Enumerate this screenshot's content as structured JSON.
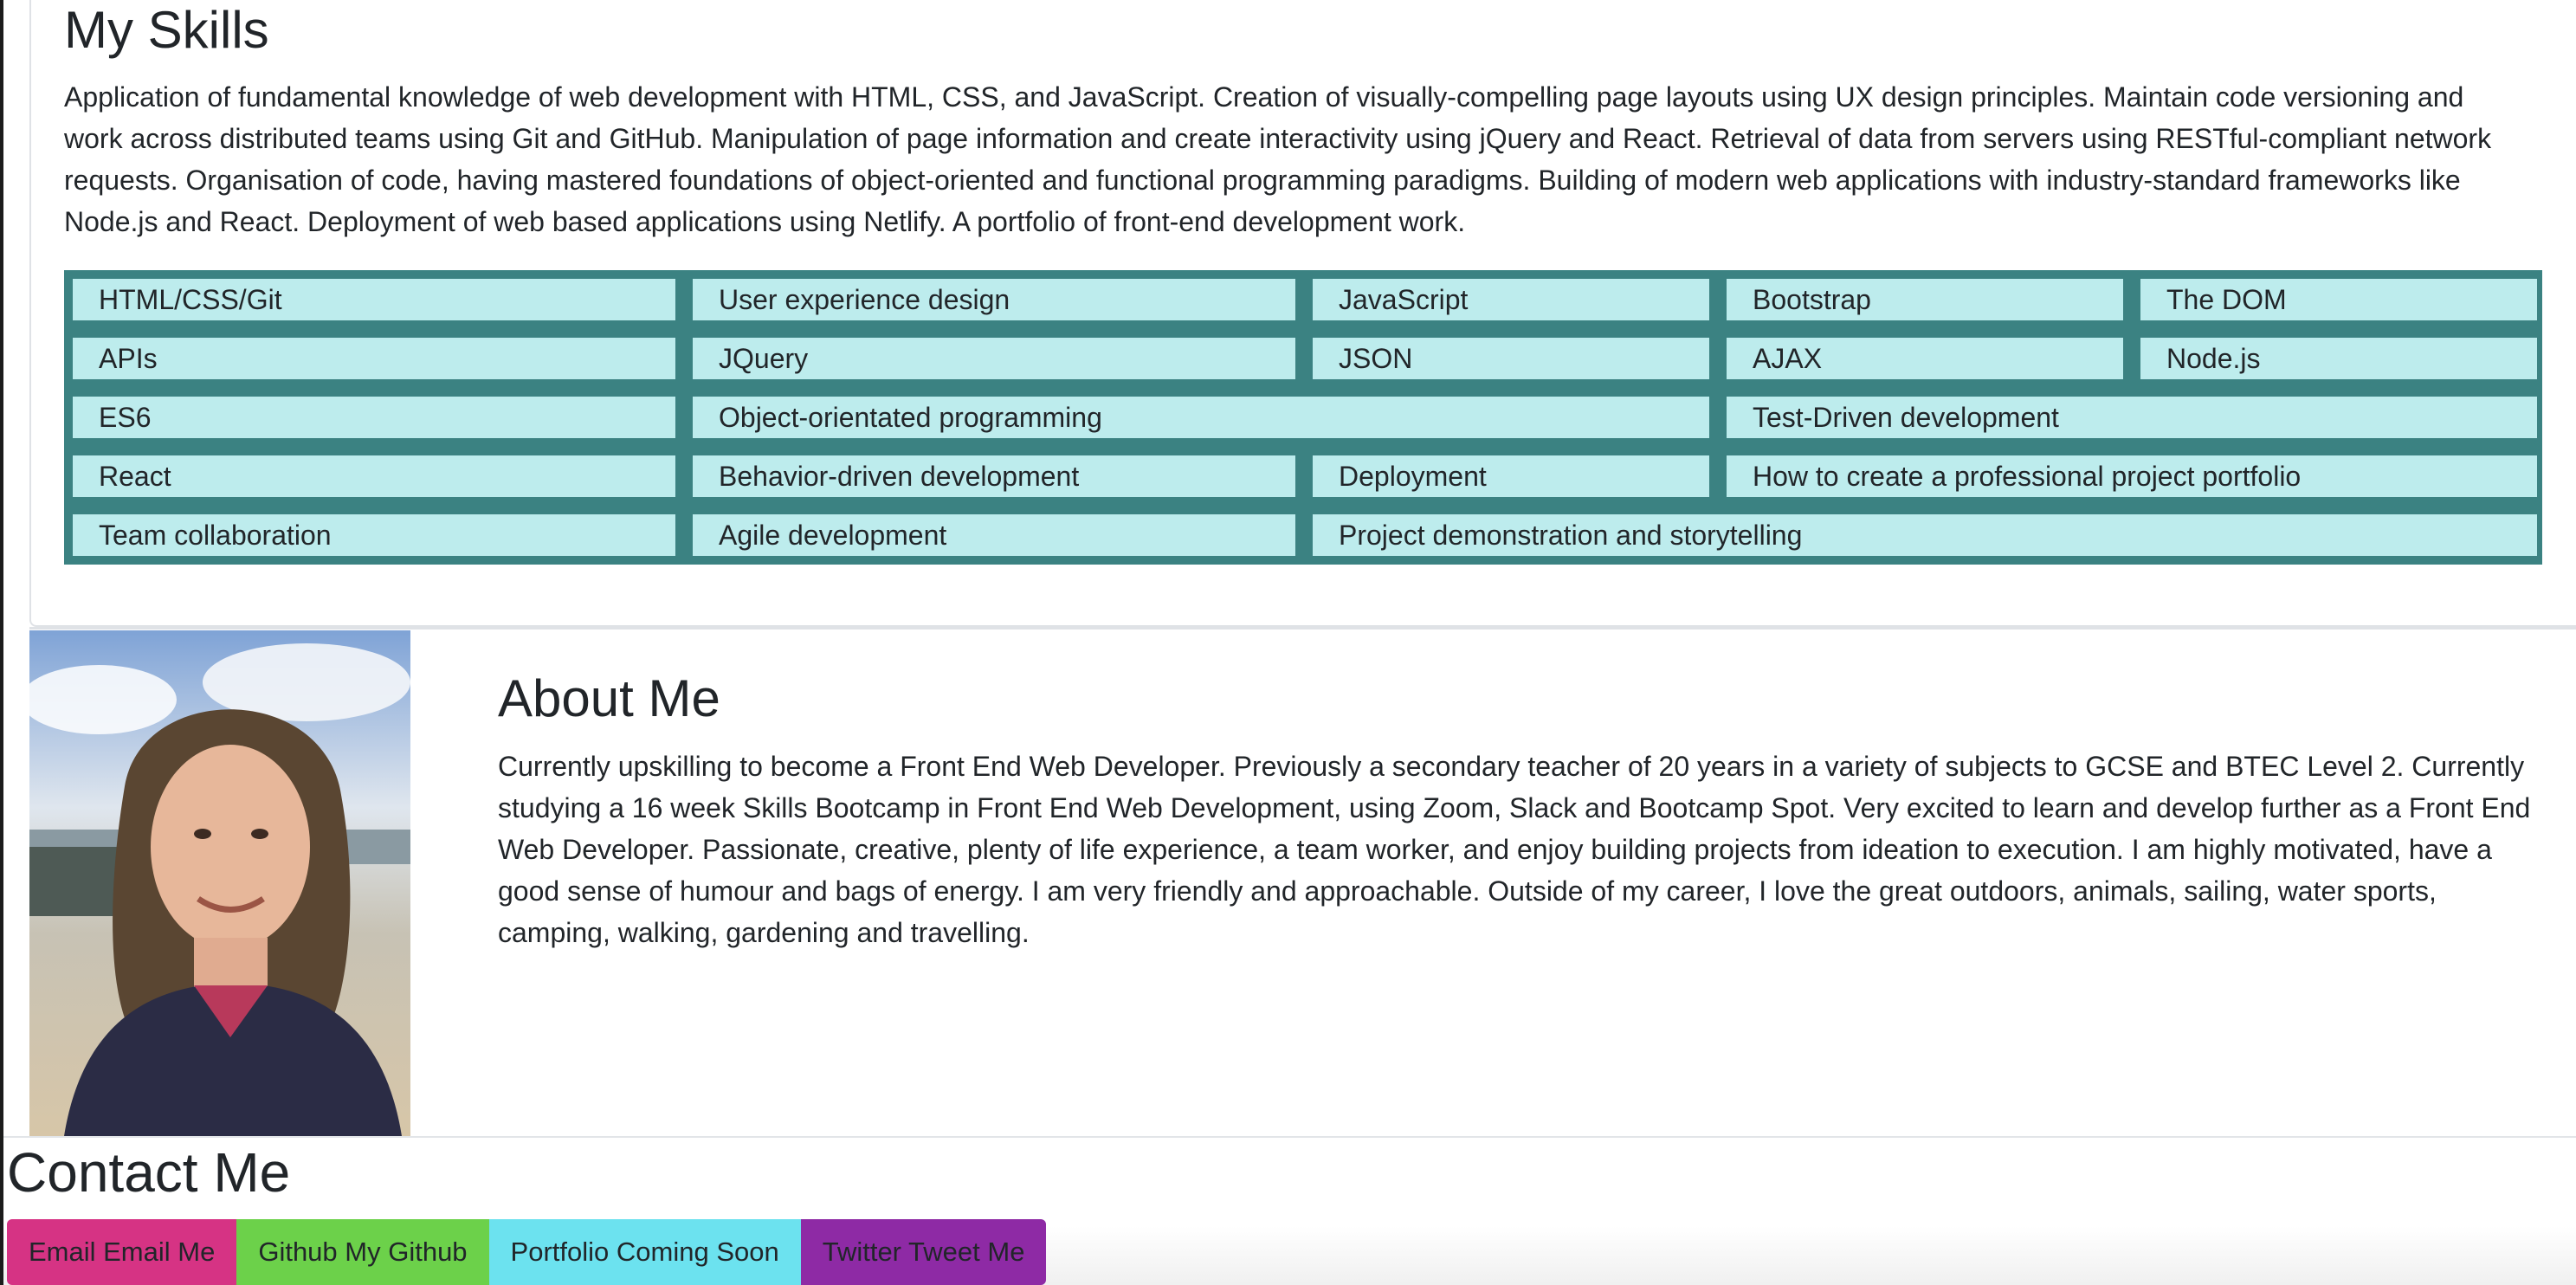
{
  "skills": {
    "title": "My Skills",
    "description": "Application of fundamental knowledge of web development with HTML, CSS, and JavaScript. Creation of visually-compelling page layouts using UX design principles. Maintain code versioning and work across distributed teams using Git and GitHub. Manipulation of page information and create interactivity using jQuery and React. Retrieval of data from servers using RESTful-compliant network requests. Organisation of code, having mastered foundations of object-oriented and functional programming paradigms. Building of modern web applications with industry-standard frameworks like Node.js and React. Deployment of web based applications using Netlify. A portfolio of front-end development work.",
    "items": [
      "HTML/CSS/Git",
      "User experience design",
      "JavaScript",
      "Bootstrap",
      "The DOM",
      "APIs",
      "JQuery",
      "JSON",
      "AJAX",
      "Node.js",
      "ES6",
      "Object-orientated programming",
      "Test-Driven development",
      "React",
      "Behavior-driven development",
      "Deployment",
      "How to create a professional project portfolio",
      "Team collaboration",
      "Agile development",
      "Project demonstration and storytelling"
    ],
    "colors": {
      "grid_bg": "#3b8282",
      "cell_bg": "#bdeced"
    }
  },
  "about": {
    "title": "About Me",
    "description": "Currently upskilling to become a Front End Web Developer. Previously a secondary teacher of 20 years in a variety of subjects to GCSE and BTEC Level 2. Currently studying a 16 week Skills Bootcamp in Front End Web Development, using Zoom, Slack and Bootcamp Spot. Very excited to learn and develop further as a Front End Web Developer. Passionate, creative, plenty of life experience, a team worker, and enjoy building projects from ideation to execution. I am highly motivated, have a good sense of humour and bags of energy. I am very friendly and approachable. Outside of my career, I love the great outdoors, animals, sailing, water sports, camping, walking, gardening and travelling."
  },
  "contact": {
    "title": "Contact Me",
    "buttons": [
      {
        "label": "Email Email Me",
        "color": "#d63384"
      },
      {
        "label": "Github My Github",
        "color": "#6cd14a"
      },
      {
        "label": "Portfolio Coming Soon",
        "color": "#6ce2ef"
      },
      {
        "label": "Twitter Tweet Me",
        "color": "#8e2aa5"
      }
    ]
  }
}
